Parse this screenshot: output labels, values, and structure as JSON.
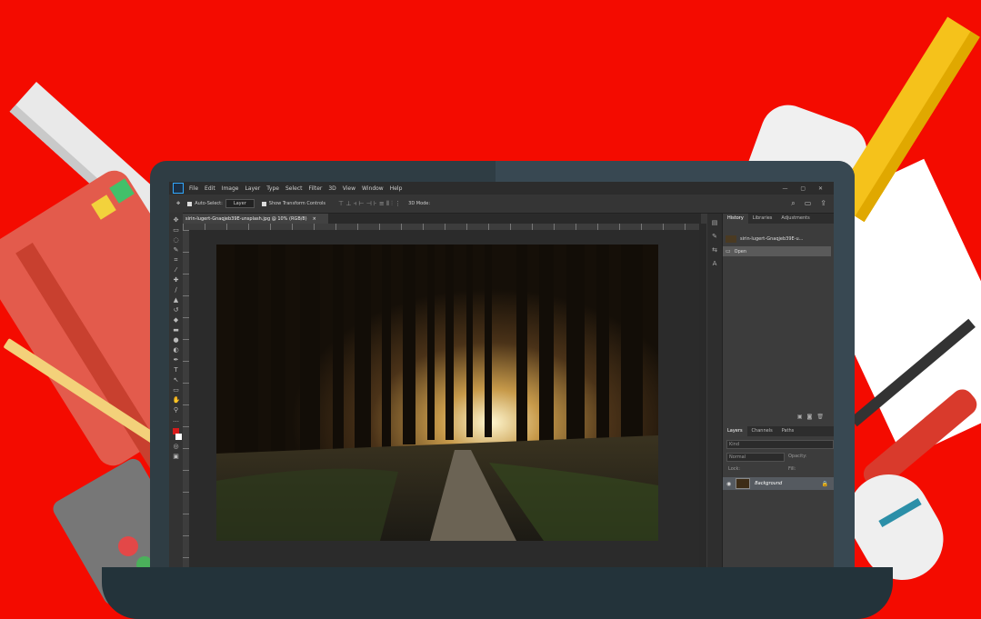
{
  "app": {
    "logo": "Ps",
    "menu": [
      "File",
      "Edit",
      "Image",
      "Layer",
      "Type",
      "Select",
      "Filter",
      "3D",
      "View",
      "Window",
      "Help"
    ],
    "window_controls": "— ▢ ✕"
  },
  "options_bar": {
    "auto_select_label": "Auto-Select:",
    "auto_select_value": "Layer",
    "transform_label": "Show Transform Controls",
    "align_icons": "⊤ ⊥ ⫞ ⊢ ⊣ ⊦ ≡ ⫴ ⫶ ⋮",
    "mode_label": "3D Mode:"
  },
  "document": {
    "tab_title": "sirin-lugert-Gnaqjeb39E-unsplash.jpg @ 10% (RGB/8)",
    "tab_close": "×"
  },
  "history_panel": {
    "tabs": [
      "History",
      "Libraries",
      "Adjustments"
    ],
    "snapshot_label": "sirin-lugert-Gnaqjeb39E-u...",
    "open_label": "Open"
  },
  "layers_panel": {
    "tabs": [
      "Layers",
      "Channels",
      "Paths"
    ],
    "filter_label": "Kind",
    "blend_mode": "Normal",
    "opacity_label": "Opacity:",
    "lock_label": "Lock:",
    "fill_label": "Fill:",
    "layer_name": "Background"
  },
  "colors": {
    "background": "#f40b00",
    "laptop": "#2f3d44",
    "foreground_swatch": "#d61b1b"
  }
}
